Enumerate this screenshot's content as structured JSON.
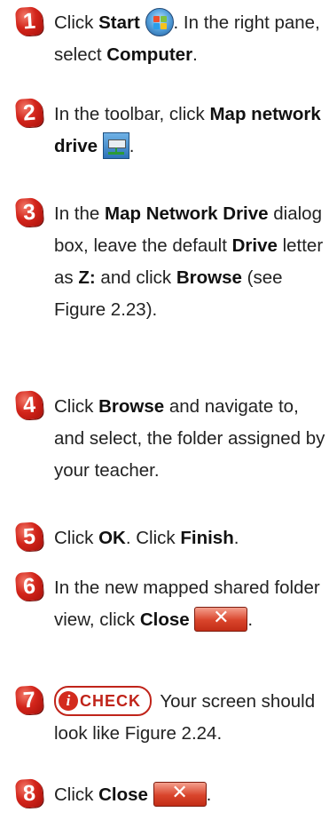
{
  "steps": [
    {
      "num": "1",
      "a": "Click ",
      "b": "Start",
      "c": ". In the right pane, select ",
      "d": "Computer",
      "e": "."
    },
    {
      "num": "2",
      "a": "In the toolbar, click ",
      "b": "Map network drive",
      "c": "."
    },
    {
      "num": "3",
      "a": "In the ",
      "b": "Map Network Drive",
      "c": " dialog box, leave the default ",
      "d": "Drive",
      "e": " letter as ",
      "f": "Z:",
      "g": " and click ",
      "h": "Browse",
      "i": " (see Figure 2.23)."
    },
    {
      "num": "4",
      "a": "Click ",
      "b": "Browse",
      "c": " and navigate to, and select, the folder assigned by your teacher."
    },
    {
      "num": "5",
      "a": "Click ",
      "b": "OK",
      "c": ". Click ",
      "d": "Finish",
      "e": "."
    },
    {
      "num": "6",
      "a": "In the new mapped shared folder view, click ",
      "b": "Close",
      "c": "."
    },
    {
      "num": "7",
      "a": " Your screen should look like Figure 2.24."
    },
    {
      "num": "8",
      "a": "Click ",
      "b": "Close",
      "c": "."
    }
  ],
  "check_badge": {
    "mark": "i",
    "label": "CHECK"
  },
  "close_glyph": "✕",
  "icons": [
    "windows-start-orb-icon",
    "map-network-drive-icon",
    "close-button-icon",
    "check-badge-icon"
  ],
  "colors": {
    "badge_red": "#d3251b",
    "check_red": "#c0241a"
  }
}
